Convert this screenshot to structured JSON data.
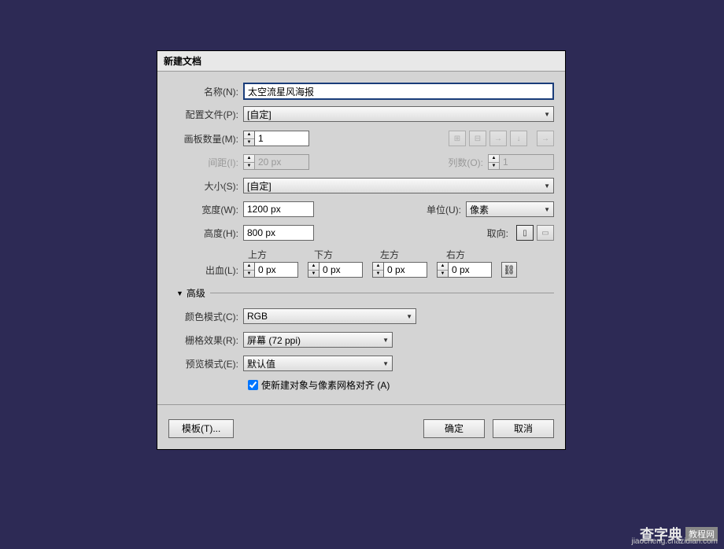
{
  "dialog": {
    "title": "新建文档",
    "name_label": "名称(N):",
    "name_value": "太空流星风海报",
    "profile_label": "配置文件(P):",
    "profile_value": "[自定]",
    "artboards_label": "画板数量(M):",
    "artboards_value": "1",
    "spacing_label": "间距(I):",
    "spacing_value": "20 px",
    "columns_label": "列数(O):",
    "columns_value": "1",
    "size_label": "大小(S):",
    "size_value": "[自定]",
    "width_label": "宽度(W):",
    "width_value": "1200 px",
    "units_label": "单位(U):",
    "units_value": "像素",
    "height_label": "高度(H):",
    "height_value": "800 px",
    "orientation_label": "取向:",
    "bleed_label": "出血(L):",
    "bleed_top_label": "上方",
    "bleed_bottom_label": "下方",
    "bleed_left_label": "左方",
    "bleed_right_label": "右方",
    "bleed_top": "0 px",
    "bleed_bottom": "0 px",
    "bleed_left": "0 px",
    "bleed_right": "0 px",
    "advanced_label": "高级",
    "color_mode_label": "颜色模式(C):",
    "color_mode_value": "RGB",
    "raster_label": "栅格效果(R):",
    "raster_value": "屏幕 (72 ppi)",
    "preview_label": "预览模式(E):",
    "preview_value": "默认值",
    "align_checkbox": "使新建对象与像素网格对齐 (A)",
    "template_btn": "模板(T)...",
    "ok_btn": "确定",
    "cancel_btn": "取消"
  },
  "watermark": {
    "brand": "查字典",
    "badge": "教程网",
    "url": "jiaocheng.chazidian.com"
  }
}
